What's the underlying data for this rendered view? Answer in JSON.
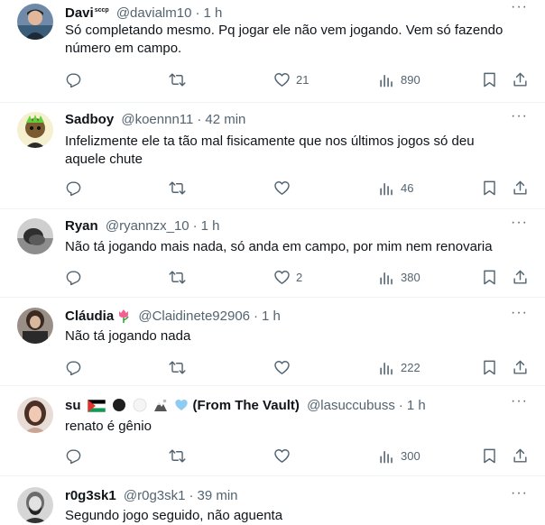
{
  "tweets": [
    {
      "name": "Davi",
      "name_sup": "sccp",
      "handle": "@davialm10",
      "time": "1 h",
      "text": "Só completando mesmo. Pq jogar ele não vem jogando. Vem só fazendo número em campo.",
      "likes": "21",
      "views": "890"
    },
    {
      "name": "Sadboy",
      "handle": "@koennn11",
      "time": "42 min",
      "text": "Infelizmente ele ta tão mal fisicamente que nos últimos jogos só deu aquele chute",
      "likes": "",
      "views": "46"
    },
    {
      "name": "Ryan",
      "handle": "@ryannzx_10",
      "time": "1 h",
      "text": "Não tá jogando mais nada, só anda em campo, por mim nem renovaria",
      "likes": "2",
      "views": "380"
    },
    {
      "name": "Cláudia",
      "name_emoji": "tulip-emoji",
      "handle": "@Claidinete92906",
      "time": "1 h",
      "text": "Não tá jogando nada",
      "likes": "",
      "views": "222"
    },
    {
      "name": "su",
      "name_suffix": "(From The Vault)",
      "name_emojis": [
        "palestine-flag-emoji",
        "black-circle-emoji",
        "white-circle-emoji",
        "mountain-emoji",
        "light-blue-heart-emoji"
      ],
      "handle": "@lasuccubuss",
      "time": "1 h",
      "text": "renato é gênio",
      "likes": "",
      "views": "300"
    },
    {
      "name": "r0g3sk1",
      "handle": "@r0g3sk1",
      "time": "39 min",
      "text": "Segundo jogo seguido, não aguenta"
    }
  ],
  "separator": "·",
  "more_label": "···",
  "colors": {
    "text_primary": "#0f1419",
    "text_secondary": "#536471",
    "divider": "#eff3f4"
  },
  "icons": [
    "reply-icon",
    "retweet-icon",
    "like-icon",
    "views-icon",
    "bookmark-icon",
    "share-icon",
    "more-icon"
  ]
}
